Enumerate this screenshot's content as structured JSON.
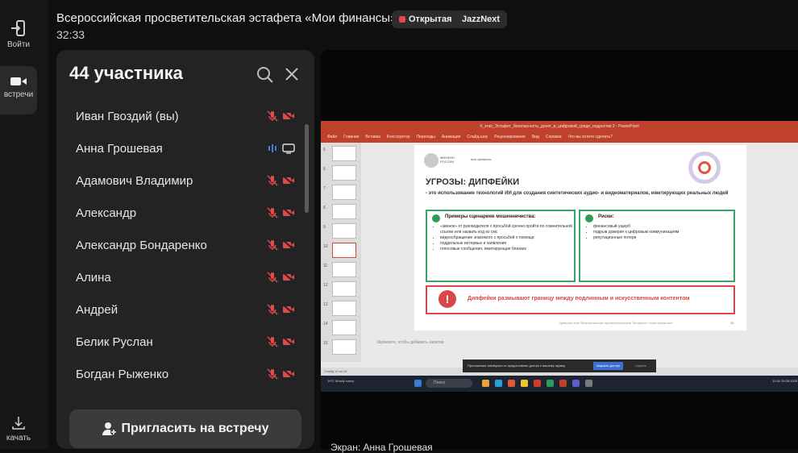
{
  "rail": {
    "login_label": "Войти",
    "meetings_label": "встречи",
    "download_label": "качать"
  },
  "header": {
    "title": "Всероссийская просветительская эстафета «Мои финансы»",
    "badge_open": "Открытая",
    "badge_jazz": "JazzNext",
    "timer": "32:33"
  },
  "participants": {
    "title": "44 участника",
    "items": [
      {
        "name": "Иван Гвоздий (вы)",
        "mic": "muted",
        "cam": "off"
      },
      {
        "name": "Анна Грошевая",
        "mic": "speaking",
        "cam": "screen-share"
      },
      {
        "name": "Адамович Владимир",
        "mic": "muted",
        "cam": "off"
      },
      {
        "name": "Александр",
        "mic": "muted",
        "cam": "off"
      },
      {
        "name": "Александр Бондаренко",
        "mic": "muted",
        "cam": "off"
      },
      {
        "name": "Алина",
        "mic": "muted",
        "cam": "off"
      },
      {
        "name": "Андрей",
        "mic": "muted",
        "cam": "off"
      },
      {
        "name": "Белик Руслан",
        "mic": "muted",
        "cam": "off"
      },
      {
        "name": "Богдан Рыженко",
        "mic": "muted",
        "cam": "off"
      }
    ],
    "invite_label": "Пригласить на встречу"
  },
  "share": {
    "label": "Экран: Анна Грошевая",
    "ppt": {
      "window_title": "4_этап_Эстафет_безопасность_денег_в_цифровой_среде_подростки 2 - PowerPoint",
      "menu": [
        "Файл",
        "Главная",
        "Вставка",
        "Конструктор",
        "Переходы",
        "Анимация",
        "Слайд-шоу",
        "Рецензирование",
        "Вид",
        "Справка",
        "Что вы хотите сделать?"
      ],
      "slide_numbers": [
        "5",
        "6",
        "7",
        "8",
        "9",
        "10",
        "11",
        "12",
        "13",
        "14",
        "15"
      ],
      "logo1_text": "МИНФИН РОССИИ",
      "logo2_text": "мои финансы",
      "slide_title": "УГРОЗЫ: ДИПФЕЙКИ",
      "slide_subtitle": "- это использование технологий ИИ для создания синтетических аудио- и видеоматериалов, имитирующих реальных людей",
      "box_left_title": "Примеры сценариев мошенничества:",
      "box_left_items": [
        "«звонок» от руководителя с просьбой срочно пройти по сомнительной ссылке или назвать код из смс",
        "видеообращение знакомого с просьбой о помощи",
        "поддельные интервью и заявления",
        "голосовые сообщения, имитирующие близких"
      ],
      "box_right_title": "Риски:",
      "box_right_items": [
        "финансовый ущерб",
        "подрыв доверия к цифровым коммуникациям",
        "репутационные потери"
      ],
      "warning_text": "Дипфейки размывают границу между подлинным и искусственным контентом",
      "footer": "Девятый этап Всероссийской просветительской Эстафеты «Мои финансы»",
      "page_number": "10",
      "notes_hint": "Щелкните, чтобы добавить заметки",
      "status": "Слайд 10 из 19",
      "toast_text": "Приложение salutspace.ru предоставлен доступ к вашему экрану",
      "toast_button": "Закрыть доступ",
      "toast_hide": "Скрыть",
      "weather": "19°C Mostly sunny",
      "search": "Поиск",
      "clock": "12:31 29.05.2025"
    }
  },
  "colors": {
    "bg": "#0f0f0f",
    "panel": "#232323",
    "muted_red": "#e34a4a",
    "speaking_blue": "#4a7bd8",
    "ppt_accent": "#c0412b",
    "slide_green": "#3aa36a",
    "slide_red": "#d94848"
  }
}
